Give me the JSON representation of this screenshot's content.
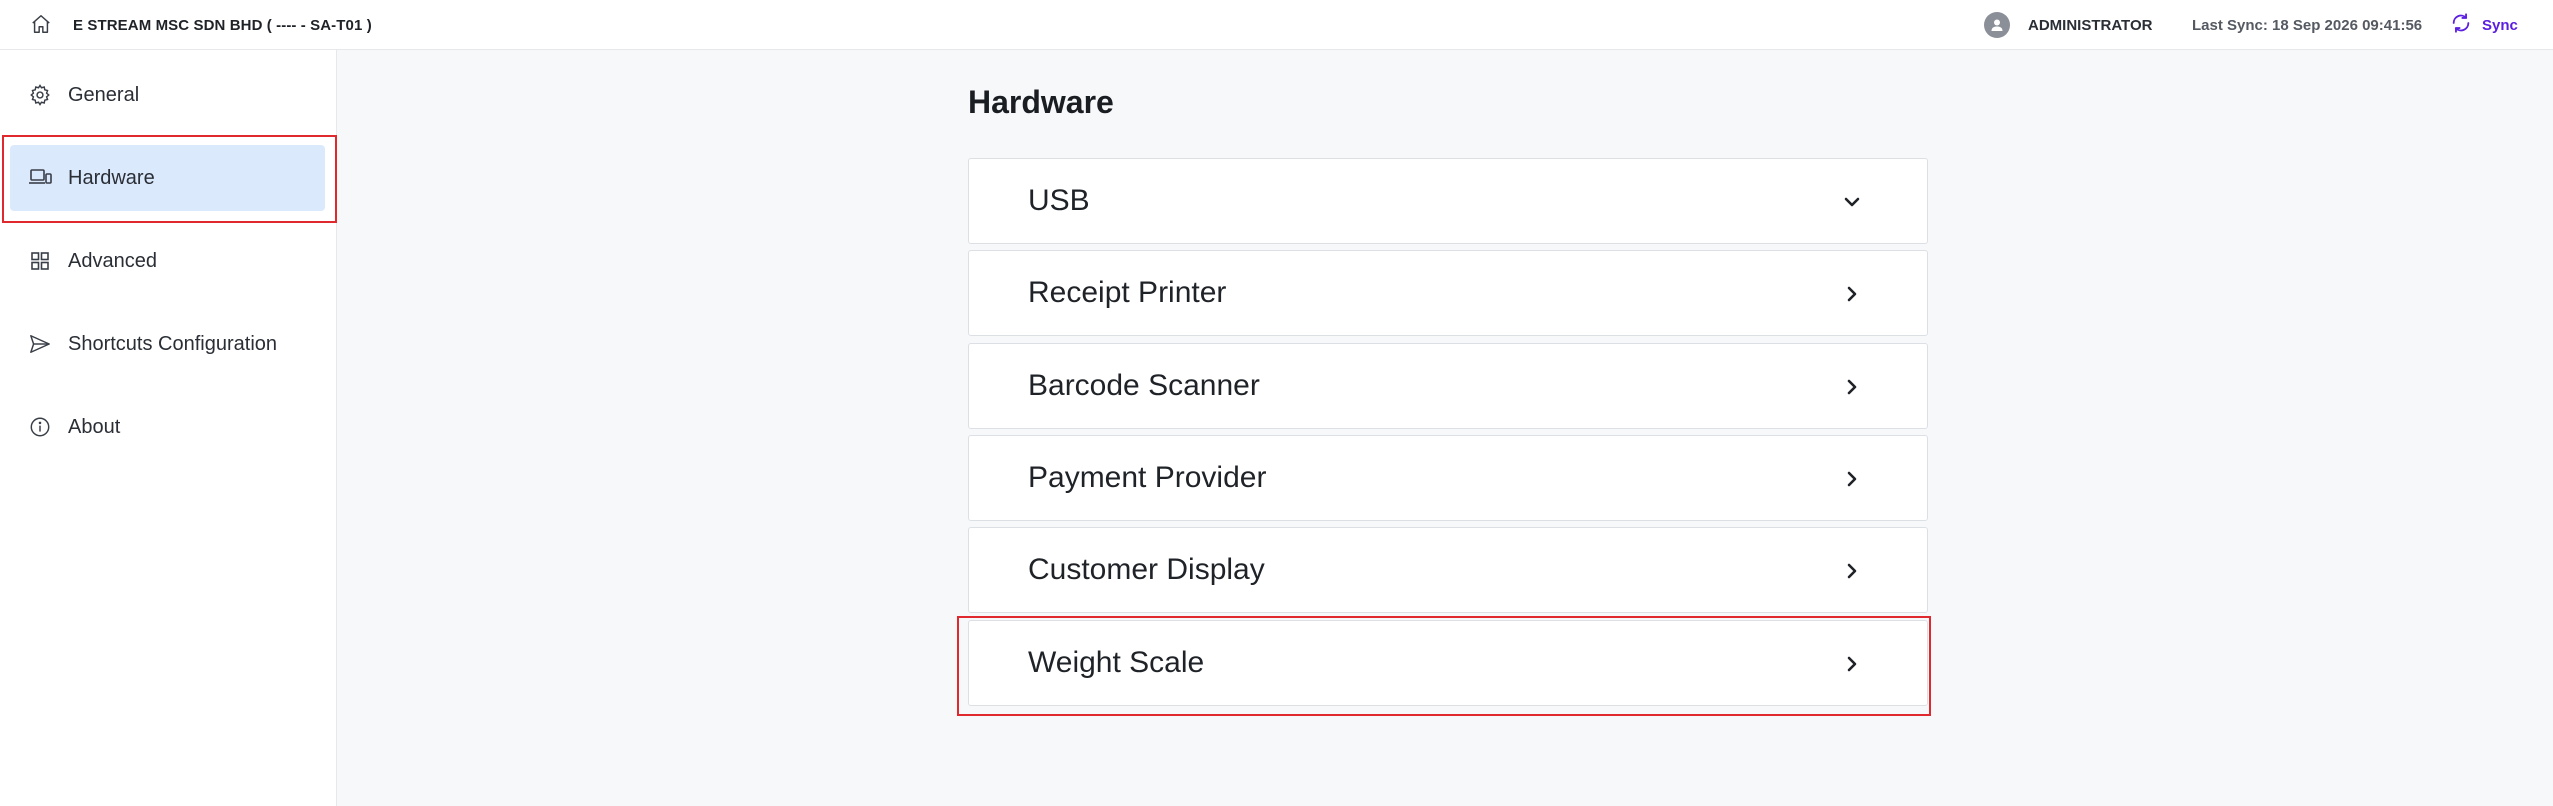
{
  "header": {
    "home_icon": "home-icon",
    "company": "E STREAM MSC SDN BHD ( ---- - SA-T01 )",
    "avatar_icon": "user-avatar-icon",
    "username": "ADMINISTRATOR",
    "last_sync": "Last Sync: 18 Sep 2026 09:41:56",
    "sync_icon": "sync-icon",
    "sync_label": "Sync",
    "accent_color": "#5b1fe0"
  },
  "sidebar": {
    "items": [
      {
        "label": "General",
        "icon": "gear-icon"
      },
      {
        "label": "Hardware",
        "icon": "devices-icon",
        "active": true
      },
      {
        "label": "Advanced",
        "icon": "grid-icon"
      },
      {
        "label": "Shortcuts Configuration",
        "icon": "send-icon"
      },
      {
        "label": "About",
        "icon": "info-icon"
      }
    ],
    "active_color": "#dbe9fd"
  },
  "main": {
    "title": "Hardware",
    "sections": [
      {
        "label": "USB",
        "state": "expanded",
        "icon": "chevron-down-icon"
      },
      {
        "label": "Receipt Printer",
        "state": "collapsed",
        "icon": "chevron-right-icon"
      },
      {
        "label": "Barcode Scanner",
        "state": "collapsed",
        "icon": "chevron-right-icon"
      },
      {
        "label": "Payment Provider",
        "state": "collapsed",
        "icon": "chevron-right-icon"
      },
      {
        "label": "Customer Display",
        "state": "collapsed",
        "icon": "chevron-right-icon"
      },
      {
        "label": "Weight Scale",
        "state": "collapsed",
        "icon": "chevron-right-icon"
      }
    ]
  },
  "highlight_color": "#e0282f"
}
